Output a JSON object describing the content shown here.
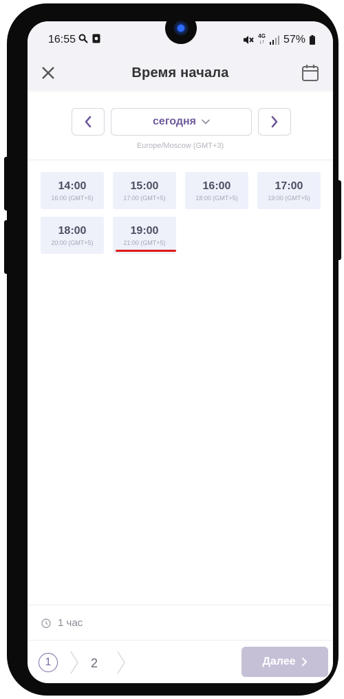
{
  "status_bar": {
    "time": "16:55",
    "battery": "57%",
    "network_top": "4G",
    "network_bottom": "↓↑"
  },
  "header": {
    "title": "Время начала"
  },
  "date_nav": {
    "selected_date": "сегодня",
    "timezone": "Europe/Moscow (GMT+3)"
  },
  "slots": [
    {
      "time": "14:00",
      "local": "16:00 (GMT+5)"
    },
    {
      "time": "15:00",
      "local": "17:00 (GMT+5)"
    },
    {
      "time": "16:00",
      "local": "18:00 (GMT+5)"
    },
    {
      "time": "17:00",
      "local": "19:00 (GMT+5)"
    },
    {
      "time": "18:00",
      "local": "20:00 (GMT+5)"
    },
    {
      "time": "19:00",
      "local": "21:00 (GMT+5)"
    }
  ],
  "footer": {
    "duration": "1 час",
    "step1": "1",
    "step2": "2",
    "next_label": "Далее"
  },
  "colors": {
    "accent": "#6e5a9c",
    "slot_bg": "#eef1fa",
    "next_disabled": "#c6c0d7",
    "highlight": "#e01818"
  }
}
